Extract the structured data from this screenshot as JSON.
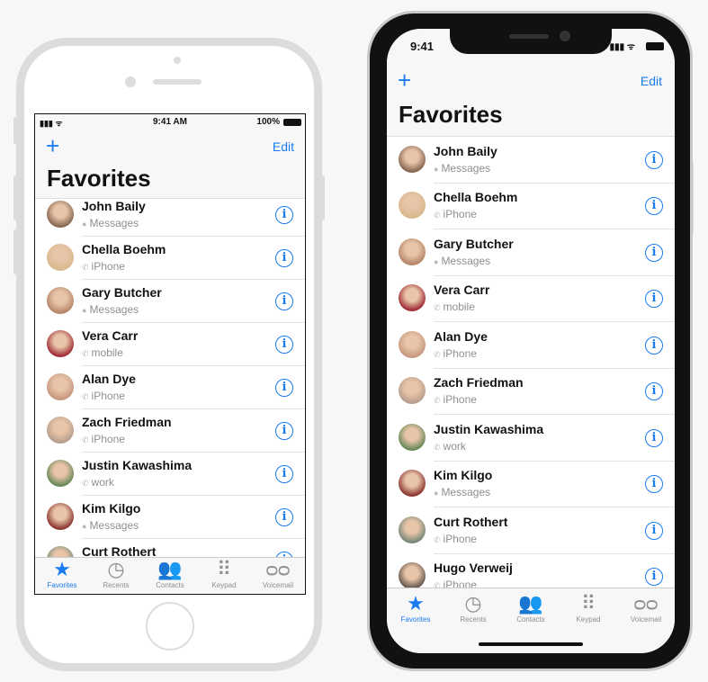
{
  "status_left": {
    "time": "9:41 AM",
    "battery": "100%"
  },
  "status_right": {
    "time": "9:41"
  },
  "nav": {
    "add_icon": "plus-icon",
    "edit": "Edit",
    "title": "Favorites"
  },
  "colors": {
    "accent": "#1a7cf0"
  },
  "contacts": [
    {
      "name": "John Baily",
      "type": "Messages",
      "icon": "message-icon",
      "avatar": "#8a6a55"
    },
    {
      "name": "Chella Boehm",
      "type": "iPhone",
      "icon": "phone-icon",
      "avatar": "#d9b98e"
    },
    {
      "name": "Gary Butcher",
      "type": "Messages",
      "icon": "message-icon",
      "avatar": "#b7876a"
    },
    {
      "name": "Vera Carr",
      "type": "mobile",
      "icon": "phone-icon",
      "avatar": "#a3303a"
    },
    {
      "name": "Alan Dye",
      "type": "iPhone",
      "icon": "phone-icon",
      "avatar": "#c89a80"
    },
    {
      "name": "Zach Friedman",
      "type": "iPhone",
      "icon": "phone-icon",
      "avatar": "#b9a08e"
    },
    {
      "name": "Justin Kawashima",
      "type": "work",
      "icon": "phone-icon",
      "avatar": "#6b8a5a"
    },
    {
      "name": "Kim Kilgo",
      "type": "Messages",
      "icon": "message-icon",
      "avatar": "#8e3a35"
    },
    {
      "name": "Curt Rothert",
      "type": "iPhone",
      "icon": "phone-icon",
      "avatar": "#7a8a7a"
    },
    {
      "name": "Hugo Verweij",
      "type": "iPhone",
      "icon": "phone-icon",
      "avatar": "#6a5a50"
    }
  ],
  "tabs": [
    {
      "label": "Favorites",
      "icon": "star-icon",
      "glyph": "★",
      "active": true
    },
    {
      "label": "Recents",
      "icon": "clock-icon",
      "glyph": "◷",
      "active": false
    },
    {
      "label": "Contacts",
      "icon": "contacts-icon",
      "glyph": "👥",
      "active": false
    },
    {
      "label": "Keypad",
      "icon": "keypad-icon",
      "glyph": "⠿",
      "active": false
    },
    {
      "label": "Voicemail",
      "icon": "voicemail-icon",
      "glyph": "ᴑᴑ",
      "active": false
    }
  ]
}
